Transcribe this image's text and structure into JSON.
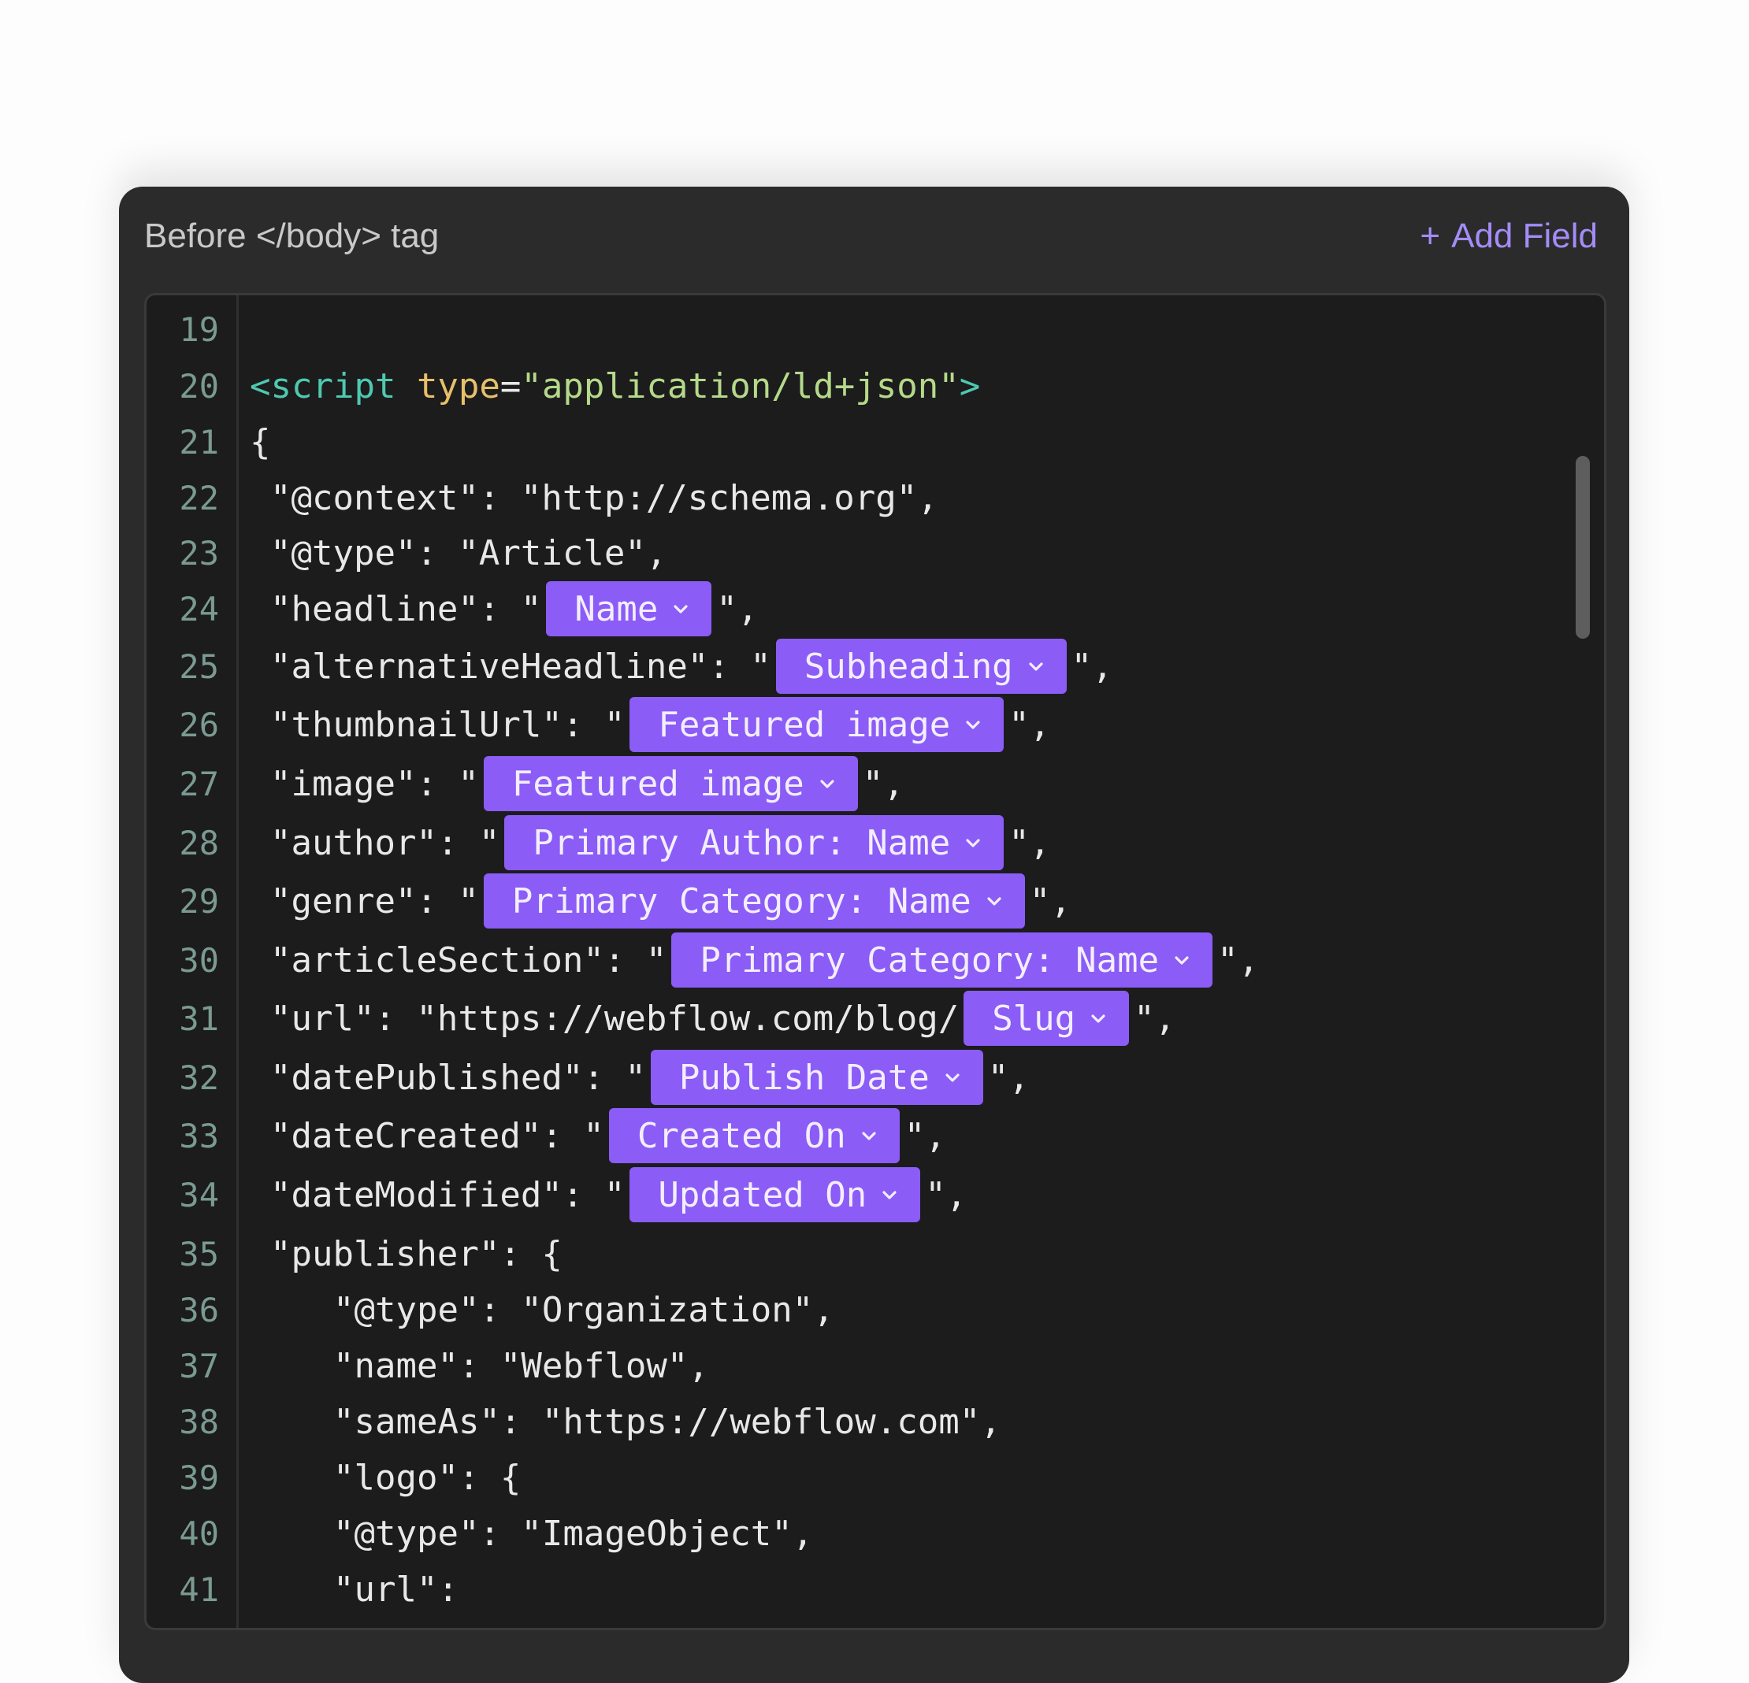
{
  "header": {
    "title": "Before </body> tag",
    "add_field_plus": "+",
    "add_field_label": "Add Field"
  },
  "lines": [
    {
      "n": "19",
      "indent": 0,
      "parts": []
    },
    {
      "n": "20",
      "indent": 0,
      "parts": [
        {
          "t": "tag",
          "v": "<script"
        },
        {
          "t": "plain",
          "v": " "
        },
        {
          "t": "attr",
          "v": "type"
        },
        {
          "t": "plain",
          "v": "="
        },
        {
          "t": "str",
          "v": "\"application/ld+json\""
        },
        {
          "t": "tag",
          "v": ">"
        }
      ]
    },
    {
      "n": "21",
      "indent": 0,
      "parts": [
        {
          "t": "plain",
          "v": "{"
        }
      ]
    },
    {
      "n": "22",
      "indent": 1,
      "parts": [
        {
          "t": "plain",
          "v": "\"@context\": \"http://schema.org\","
        }
      ]
    },
    {
      "n": "23",
      "indent": 1,
      "parts": [
        {
          "t": "plain",
          "v": "\"@type\": \"Article\","
        }
      ]
    },
    {
      "n": "24",
      "indent": 1,
      "parts": [
        {
          "t": "plain",
          "v": "\"headline\": \""
        },
        {
          "t": "pill",
          "v": "Name"
        },
        {
          "t": "plain",
          "v": "\","
        }
      ]
    },
    {
      "n": "25",
      "indent": 1,
      "parts": [
        {
          "t": "plain",
          "v": "\"alternativeHeadline\": \""
        },
        {
          "t": "pill",
          "v": "Subheading"
        },
        {
          "t": "plain",
          "v": "\","
        }
      ]
    },
    {
      "n": "26",
      "indent": 1,
      "parts": [
        {
          "t": "plain",
          "v": "\"thumbnailUrl\": \""
        },
        {
          "t": "pill",
          "v": "Featured image"
        },
        {
          "t": "plain",
          "v": "\","
        }
      ]
    },
    {
      "n": "27",
      "indent": 1,
      "parts": [
        {
          "t": "plain",
          "v": "\"image\": \""
        },
        {
          "t": "pill",
          "v": "Featured image"
        },
        {
          "t": "plain",
          "v": "\","
        }
      ]
    },
    {
      "n": "28",
      "indent": 1,
      "parts": [
        {
          "t": "plain",
          "v": "\"author\": \""
        },
        {
          "t": "pill",
          "v": "Primary Author: Name"
        },
        {
          "t": "plain",
          "v": "\","
        }
      ]
    },
    {
      "n": "29",
      "indent": 1,
      "parts": [
        {
          "t": "plain",
          "v": "\"genre\": \""
        },
        {
          "t": "pill",
          "v": "Primary Category: Name"
        },
        {
          "t": "plain",
          "v": "\","
        }
      ]
    },
    {
      "n": "30",
      "indent": 1,
      "parts": [
        {
          "t": "plain",
          "v": "\"articleSection\": \""
        },
        {
          "t": "pill",
          "v": "Primary Category: Name"
        },
        {
          "t": "plain",
          "v": "\","
        }
      ]
    },
    {
      "n": "31",
      "indent": 1,
      "parts": [
        {
          "t": "plain",
          "v": "\"url\": \"https://webflow.com/blog/"
        },
        {
          "t": "pill",
          "v": "Slug"
        },
        {
          "t": "plain",
          "v": "\","
        }
      ]
    },
    {
      "n": "32",
      "indent": 1,
      "parts": [
        {
          "t": "plain",
          "v": "\"datePublished\": \""
        },
        {
          "t": "pill",
          "v": "Publish Date"
        },
        {
          "t": "plain",
          "v": "\","
        }
      ]
    },
    {
      "n": "33",
      "indent": 1,
      "parts": [
        {
          "t": "plain",
          "v": "\"dateCreated\": \""
        },
        {
          "t": "pill",
          "v": "Created On"
        },
        {
          "t": "plain",
          "v": "\","
        }
      ]
    },
    {
      "n": "34",
      "indent": 1,
      "parts": [
        {
          "t": "plain",
          "v": "\"dateModified\": \""
        },
        {
          "t": "pill",
          "v": "Updated On"
        },
        {
          "t": "plain",
          "v": "\","
        }
      ]
    },
    {
      "n": "35",
      "indent": 1,
      "parts": [
        {
          "t": "plain",
          "v": "\"publisher\": {"
        }
      ]
    },
    {
      "n": "36",
      "indent": 2,
      "parts": [
        {
          "t": "plain",
          "v": "\"@type\": \"Organization\","
        }
      ]
    },
    {
      "n": "37",
      "indent": 2,
      "parts": [
        {
          "t": "plain",
          "v": "\"name\": \"Webflow\","
        }
      ]
    },
    {
      "n": "38",
      "indent": 2,
      "parts": [
        {
          "t": "plain",
          "v": "\"sameAs\": \"https://webflow.com\","
        }
      ]
    },
    {
      "n": "39",
      "indent": 2,
      "parts": [
        {
          "t": "plain",
          "v": "\"logo\": {"
        }
      ]
    },
    {
      "n": "40",
      "indent": 2,
      "parts": [
        {
          "t": "plain",
          "v": "\"@type\": \"ImageObject\","
        }
      ]
    },
    {
      "n": "41",
      "indent": 2,
      "parts": [
        {
          "t": "plain",
          "v": "\"url\":"
        }
      ]
    }
  ],
  "colors": {
    "panel_bg": "#2b2b2b",
    "editor_bg": "#1c1c1c",
    "pill_bg": "#8b5cf6",
    "accent": "#a48cf8",
    "tag": "#4ec9b0",
    "attr": "#e6c06a",
    "string": "#b5d98a"
  },
  "icons": {
    "pill_chevron": "chevron-down-icon",
    "add_field": "plus-icon"
  }
}
